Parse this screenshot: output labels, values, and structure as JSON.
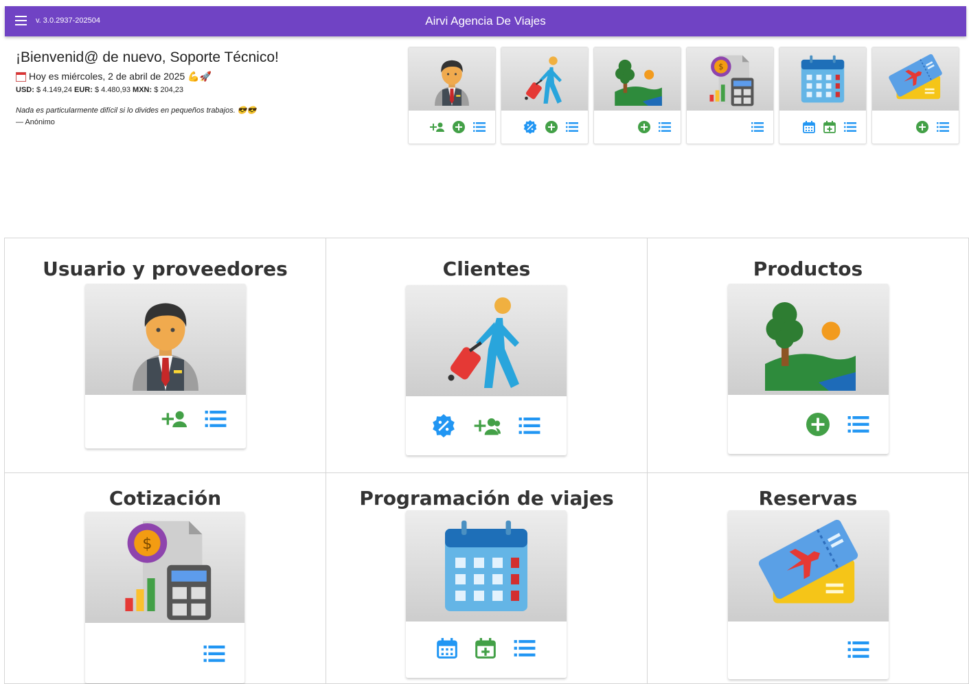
{
  "app_bar": {
    "version": "v. 3.0.2937-202504",
    "title": "Airvi Agencia De Viajes"
  },
  "welcome": {
    "greeting": "¡Bienvenid@ de nuevo, Soporte Técnico!",
    "date": "Hoy es miércoles, 2 de abril de 2025 💪🚀",
    "rates": [
      {
        "code": "USD:",
        "value": "$ 4.149,24"
      },
      {
        "code": "EUR:",
        "value": "$ 4.480,93"
      },
      {
        "code": "MXN:",
        "value": "$ 204,23"
      }
    ],
    "quote": "Nada es particularmente difícil si lo divides en pequeños trabajos. 😎😎",
    "author": "— Anónimo"
  },
  "sections": [
    {
      "title": "Usuario y proveedores",
      "image": "employee-icon",
      "actions": [
        "add-user-icon",
        "list-icon"
      ]
    },
    {
      "title": "Clientes",
      "image": "traveler-icon",
      "actions": [
        "discount-icon",
        "add-group-icon",
        "list-icon"
      ]
    },
    {
      "title": "Productos",
      "image": "landscape-icon",
      "actions": [
        "add-circle-icon",
        "list-icon"
      ]
    },
    {
      "title": "Cotización",
      "image": "calculator-icon",
      "actions": [
        "list-icon"
      ]
    },
    {
      "title": "Programación de viajes",
      "image": "calendar-icon",
      "actions": [
        "calendar-view-icon",
        "calendar-add-icon",
        "list-icon"
      ]
    },
    {
      "title": "Reservas",
      "image": "ticket-icon",
      "actions": [
        "list-icon"
      ]
    }
  ],
  "colors": {
    "app_bar": "#7043c4",
    "action_blue": "#2196f3",
    "action_green": "#43a047"
  }
}
